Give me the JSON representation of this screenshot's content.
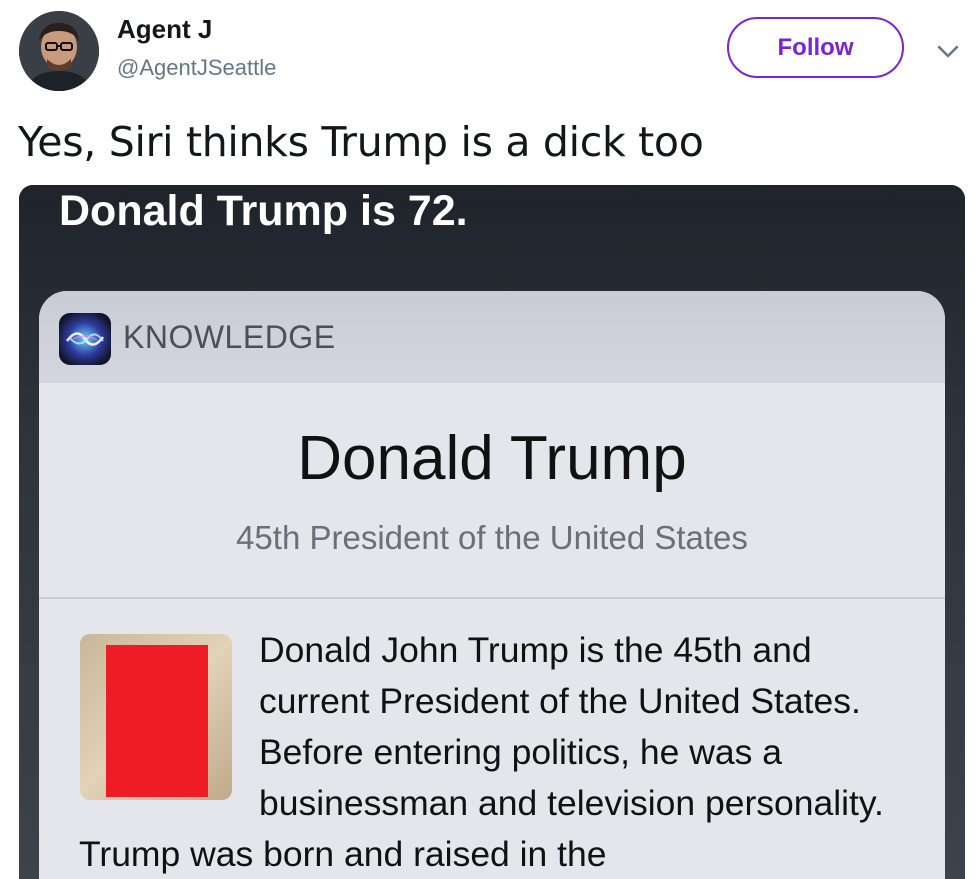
{
  "tweet": {
    "author": {
      "name": "Agent J",
      "handle": "@AgentJSeattle"
    },
    "follow_label": "Follow",
    "text": "Yes, Siri thinks Trump is a dick too"
  },
  "media": {
    "siri_answer": "Donald Trump is 72.",
    "card": {
      "section_label": "KNOWLEDGE",
      "entity_name": "Donald Trump",
      "entity_subtitle": "45th President of the United States",
      "summary": "Donald John Trump is the 45th and current President of the United States. Before entering politics, he was a businessman and television personality. Trump was born and raised in the"
    }
  },
  "colors": {
    "accent": "#7b24d6",
    "handle": "#657786",
    "redaction": "#ee1c25"
  }
}
